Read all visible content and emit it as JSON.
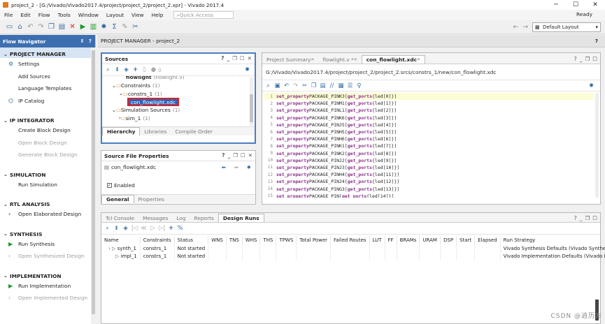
{
  "titlebar": {
    "title": "project_2 - [G:/Vivado/Vivado2017.4/project/project_2/project_2.xpr] - Vivado 2017.4",
    "min": "─",
    "max": "☐",
    "close": "✕"
  },
  "menubar": {
    "items": [
      "File",
      "Edit",
      "Flow",
      "Tools",
      "Window",
      "Layout",
      "View",
      "Help"
    ],
    "quick_access_placeholder": "Quick Access",
    "status": "Ready"
  },
  "toolbar": {
    "layout_select": "Default Layout"
  },
  "flow_navigator": {
    "title": "Flow Navigator",
    "sections": [
      {
        "title": "PROJECT MANAGER",
        "items": [
          {
            "label": "Settings",
            "enabled": true,
            "icon": "gear"
          },
          {
            "label": "Add Sources",
            "enabled": true
          },
          {
            "label": "Language Templates",
            "enabled": true
          },
          {
            "label": "IP Catalog",
            "enabled": true,
            "icon": "ip"
          }
        ]
      },
      {
        "title": "IP INTEGRATOR",
        "items": [
          {
            "label": "Create Block Design",
            "enabled": true
          },
          {
            "label": "Open Block Design",
            "enabled": false
          },
          {
            "label": "Generate Block Design",
            "enabled": false
          }
        ]
      },
      {
        "title": "SIMULATION",
        "items": [
          {
            "label": "Run Simulation",
            "enabled": true
          }
        ]
      },
      {
        "title": "RTL ANALYSIS",
        "items": [
          {
            "label": "Open Elaborated Design",
            "enabled": true,
            "icon": "expand"
          }
        ]
      },
      {
        "title": "SYNTHESIS",
        "items": [
          {
            "label": "Run Synthesis",
            "enabled": true,
            "icon": "play"
          },
          {
            "label": "Open Synthesized Design",
            "enabled": false,
            "icon": "expand"
          }
        ]
      },
      {
        "title": "IMPLEMENTATION",
        "items": [
          {
            "label": "Run Implementation",
            "enabled": true,
            "icon": "play"
          },
          {
            "label": "Open Implemented Design",
            "enabled": false,
            "icon": "expand"
          }
        ]
      }
    ]
  },
  "project_manager": {
    "header": "PROJECT MANAGER - project_2"
  },
  "sources": {
    "title": "Sources",
    "badge": "0",
    "tree": [
      {
        "text": "flowlight",
        "extra": "(flowlight.v)",
        "indent": 3
      },
      {
        "text": "Constraints",
        "extra": "(1)",
        "indent": 1
      },
      {
        "text": "constrs_1",
        "extra": "(1)",
        "indent": 2
      },
      {
        "text": "con_flowlight.xdc",
        "extra": "",
        "indent": 3,
        "selected": true
      },
      {
        "text": "Simulation Sources",
        "extra": "(1)",
        "indent": 1
      },
      {
        "text": "sim_1",
        "extra": "(1)",
        "indent": 2
      }
    ],
    "tabs": [
      "Hierarchy",
      "Libraries",
      "Compile Order"
    ]
  },
  "source_props": {
    "title": "Source File Properties",
    "file": "con_flowlight.xdc",
    "enabled_label": "Enabled",
    "tabs": [
      "General",
      "Properties"
    ]
  },
  "editor": {
    "tabs": [
      "Project Summary",
      "flowlight.v *",
      "con_flowlight.xdc"
    ],
    "path": "G:/Vivado/Vivado2017.4/project/project_2/project_2.srcs/constrs_1/new/con_flowlight.xdc",
    "lines": [
      {
        "n": "1",
        "pin": "K3",
        "idx": "0"
      },
      {
        "n": "2",
        "pin": "M1",
        "idx": "1"
      },
      {
        "n": "3",
        "pin": "L1",
        "idx": "2"
      },
      {
        "n": "4",
        "pin": "K6",
        "idx": "3"
      },
      {
        "n": "5",
        "pin": "J5",
        "idx": "4"
      },
      {
        "n": "6",
        "pin": "H5",
        "idx": "5"
      },
      {
        "n": "7",
        "pin": "H6",
        "idx": "6"
      },
      {
        "n": "8",
        "pin": "K1",
        "idx": "7"
      },
      {
        "n": "9",
        "pin": "K2",
        "idx": "8"
      },
      {
        "n": "10",
        "pin": "J2",
        "idx": "9"
      },
      {
        "n": "11",
        "pin": "J3",
        "idx": "10"
      },
      {
        "n": "12",
        "pin": "H4",
        "idx": "11"
      },
      {
        "n": "13",
        "pin": "J4",
        "idx": "12"
      },
      {
        "n": "14",
        "pin": "G3",
        "idx": "13"
      },
      {
        "n": "15",
        "pin": "",
        "idx": "14"
      }
    ],
    "kw_set": "set_property",
    "kw_pkg": "PACKAGE_PIN",
    "kw_get": "get_ports",
    "port": "led"
  },
  "bottom": {
    "tabs": [
      "Tcl Console",
      "Messages",
      "Log",
      "Reports",
      "Design Runs"
    ],
    "columns": [
      "Name",
      "Constraints",
      "Status",
      "WNS",
      "TNS",
      "WHS",
      "THS",
      "TPWS",
      "Total Power",
      "Failed Routes",
      "LUT",
      "FF",
      "BRAMs",
      "URAM",
      "DSP",
      "Start",
      "Elapsed",
      "Run Strategy"
    ],
    "rows": [
      {
        "name": "synth_1",
        "constraints": "constrs_1",
        "status": "Not started",
        "strategy": "Vivado Synthesis Defaults (Vivado Synthesis"
      },
      {
        "name": "impl_1",
        "constraints": "constrs_1",
        "status": "Not started",
        "strategy": "Vivado Implementation Defaults (Vivado Imp"
      }
    ]
  },
  "watermark": "CSDN @逍历方",
  "colors": {
    "accent": "#3d6fb0",
    "highlight_red": "#e02020",
    "keyword": "#8a2b8a"
  }
}
